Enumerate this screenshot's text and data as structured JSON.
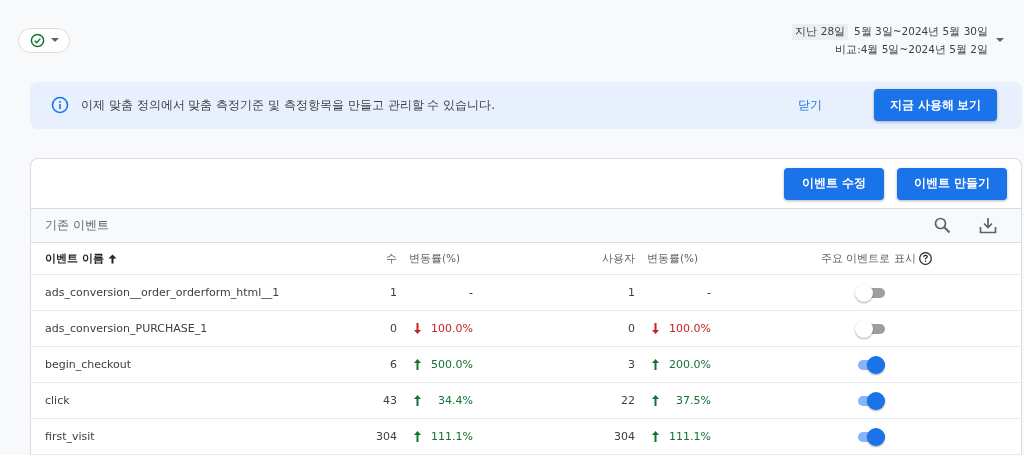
{
  "filter_chip": {
    "checked": true
  },
  "date_range": {
    "preset": "지난 28일",
    "range": "5월 3일~2024년 5월 30일",
    "compare": "비교:4월 5일~2024년 5월 2일"
  },
  "banner": {
    "message": "이제 맞춤 정의에서 맞춤 측정기준 및 측정항목을 만들고 관리할 수 있습니다.",
    "dismiss": "닫기",
    "action": "지금 사용해 보기"
  },
  "actions": [
    "이벤트 수정",
    "이벤트 만들기"
  ],
  "section_title": "기존 이벤트",
  "columns": {
    "name": "이벤트 이름",
    "count": "수",
    "count_change": "변동률(%)",
    "users": "사용자",
    "users_change": "변동률(%)",
    "key_event": "주요 이벤트로 표시"
  },
  "rows": [
    {
      "name": "ads_conversion__order_orderform_html__1",
      "count": "1",
      "count_change": {
        "kind": "none",
        "value": "-"
      },
      "users": "1",
      "users_change": {
        "kind": "none",
        "value": "-"
      },
      "key_event": false
    },
    {
      "name": "ads_conversion_PURCHASE_1",
      "count": "0",
      "count_change": {
        "kind": "down",
        "value": "100.0%"
      },
      "users": "0",
      "users_change": {
        "kind": "down",
        "value": "100.0%"
      },
      "key_event": false
    },
    {
      "name": "begin_checkout",
      "count": "6",
      "count_change": {
        "kind": "up",
        "value": "500.0%"
      },
      "users": "3",
      "users_change": {
        "kind": "up",
        "value": "200.0%"
      },
      "key_event": true
    },
    {
      "name": "click",
      "count": "43",
      "count_change": {
        "kind": "up",
        "value": "34.4%"
      },
      "users": "22",
      "users_change": {
        "kind": "up",
        "value": "37.5%"
      },
      "key_event": true
    },
    {
      "name": "first_visit",
      "count": "304",
      "count_change": {
        "kind": "up",
        "value": "111.1%"
      },
      "users": "304",
      "users_change": {
        "kind": "up",
        "value": "111.1%"
      },
      "key_event": true
    }
  ]
}
